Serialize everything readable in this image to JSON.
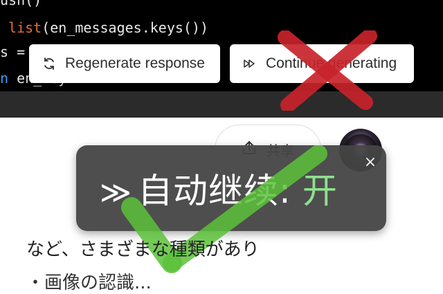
{
  "code": {
    "lines": [
      {
        "text": "ush()"
      },
      {
        "prefix": " ",
        "kw": "list",
        "rest": "(en_messages.keys())"
      },
      {
        "text": "s = "
      },
      {
        "kw": "n",
        "rest": " en_key"
      }
    ]
  },
  "buttons": {
    "regenerate": {
      "label": "Regenerate response",
      "icon": "refresh-icon"
    },
    "continue": {
      "label": "Continue generating",
      "icon": "fast-forward-icon"
    }
  },
  "share": {
    "label": "共享",
    "icon": "share-icon"
  },
  "toast": {
    "arrows": "≫",
    "label": "自动继续:",
    "value": "开",
    "close": "×",
    "colors": {
      "background": "#444444",
      "value": "#8ee08e"
    }
  },
  "overlays": {
    "cross_color": "#c8232b",
    "check_color": "#5cc23a"
  },
  "body": {
    "line1": "など、さまざまな種類があり",
    "line2": "・画像の認識..."
  }
}
